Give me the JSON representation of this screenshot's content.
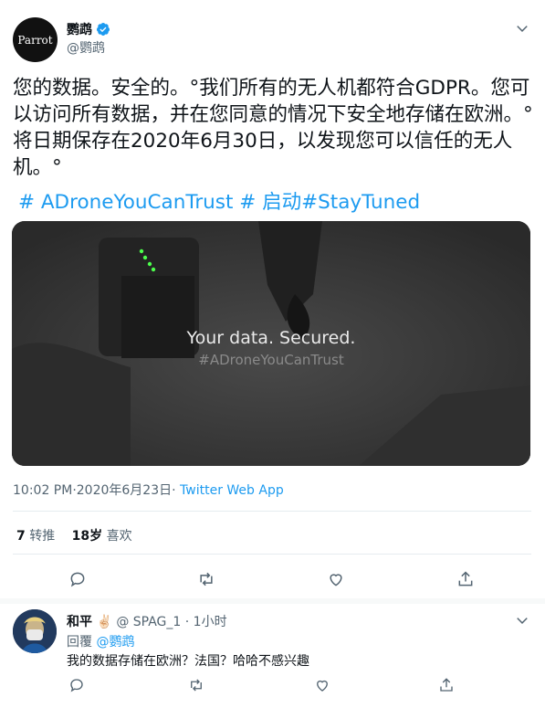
{
  "tweet": {
    "avatar_text": "Parrot",
    "display_name": "鹦鹉",
    "handle": "@鹦鹉",
    "text": "您的数据。安全的。°我们所有的无人机都符合GDPR。您可以访问所有数据，并在您同意的情况下安全地存储在欧洲。°将日期保存在2020年6月30日，以发现您可以信任的无人机。°",
    "hashtags": "# ADroneYouCanTrust # 启动#StayTuned",
    "media": {
      "title": "Your data. Secured.",
      "tagline": "#ADroneYouCanTrust"
    },
    "time": "10:02 PM·2020年6月23日·",
    "app": "Twitter Web App",
    "retweets_count": "7",
    "retweets_label": "转推",
    "likes_count": "18岁",
    "likes_label": "喜欢"
  },
  "reply": {
    "display_name": "和平",
    "emoji": "✌🏻",
    "handle": "@ SPAG_1",
    "time": "· 1小时",
    "replying_label": "回覆",
    "replying_to": "@鹦鹉",
    "text": "我的数据存储在欧洲？法国？哈哈不感兴趣"
  },
  "colors": {
    "accent": "#1d9bf0",
    "secondary_text": "#536471",
    "divider": "#e6ecf0"
  }
}
